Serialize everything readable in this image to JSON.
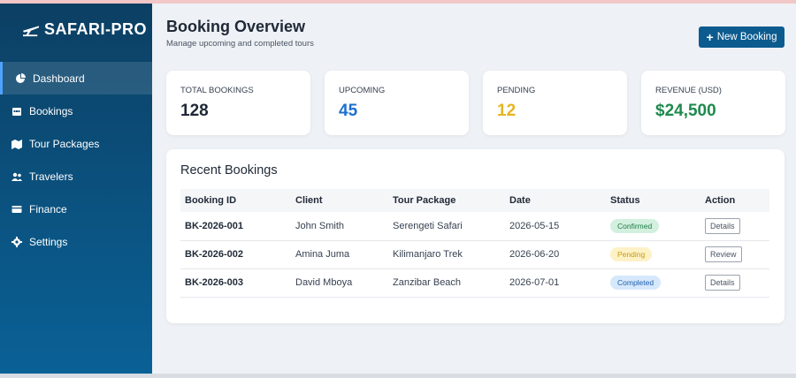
{
  "app": {
    "brand": "SAFARI-PRO"
  },
  "sidebar": {
    "items": [
      {
        "label": "Dashboard",
        "icon": "dashboard-icon",
        "active": true
      },
      {
        "label": "Bookings",
        "icon": "calendar-icon"
      },
      {
        "label": "Tour Packages",
        "icon": "map-icon"
      },
      {
        "label": "Travelers",
        "icon": "users-icon"
      },
      {
        "label": "Finance",
        "icon": "wallet-icon"
      },
      {
        "label": "Settings",
        "icon": "gear-icon"
      }
    ]
  },
  "header": {
    "title": "Booking Overview",
    "subtitle": "Manage upcoming and completed tours",
    "new_button": "New Booking"
  },
  "stats": [
    {
      "label": "TOTAL BOOKINGS",
      "value": "128",
      "color": "#1f2937"
    },
    {
      "label": "UPCOMING",
      "value": "45",
      "color": "#1d6fd1"
    },
    {
      "label": "PENDING",
      "value": "12",
      "color": "#e6b422"
    },
    {
      "label": "REVENUE (USD)",
      "value": "$24,500",
      "color": "#1e8a4e"
    }
  ],
  "recent": {
    "title": "Recent Bookings",
    "columns": [
      "Booking ID",
      "Client",
      "Tour Package",
      "Date",
      "Status",
      "Action"
    ],
    "rows": [
      {
        "id": "BK-2026-001",
        "client": "John Smith",
        "package": "Serengeti Safari",
        "date": "2026-05-15",
        "status": "Confirmed",
        "action": "Details"
      },
      {
        "id": "BK-2026-002",
        "client": "Amina Juma",
        "package": "Kilimanjaro Trek",
        "date": "2026-06-20",
        "status": "Pending",
        "action": "Review"
      },
      {
        "id": "BK-2026-003",
        "client": "David Mboya",
        "package": "Zanzibar Beach",
        "date": "2026-07-01",
        "status": "Completed",
        "action": "Details"
      }
    ]
  },
  "colors": {
    "accent": "#0b5b8f",
    "confirmed_bg": "#d3f0df",
    "confirmed_fg": "#1e7a47",
    "pending_bg": "#fdf1c6",
    "pending_fg": "#c99a10",
    "completed_bg": "#d6e8fb",
    "completed_fg": "#1d5fae"
  }
}
